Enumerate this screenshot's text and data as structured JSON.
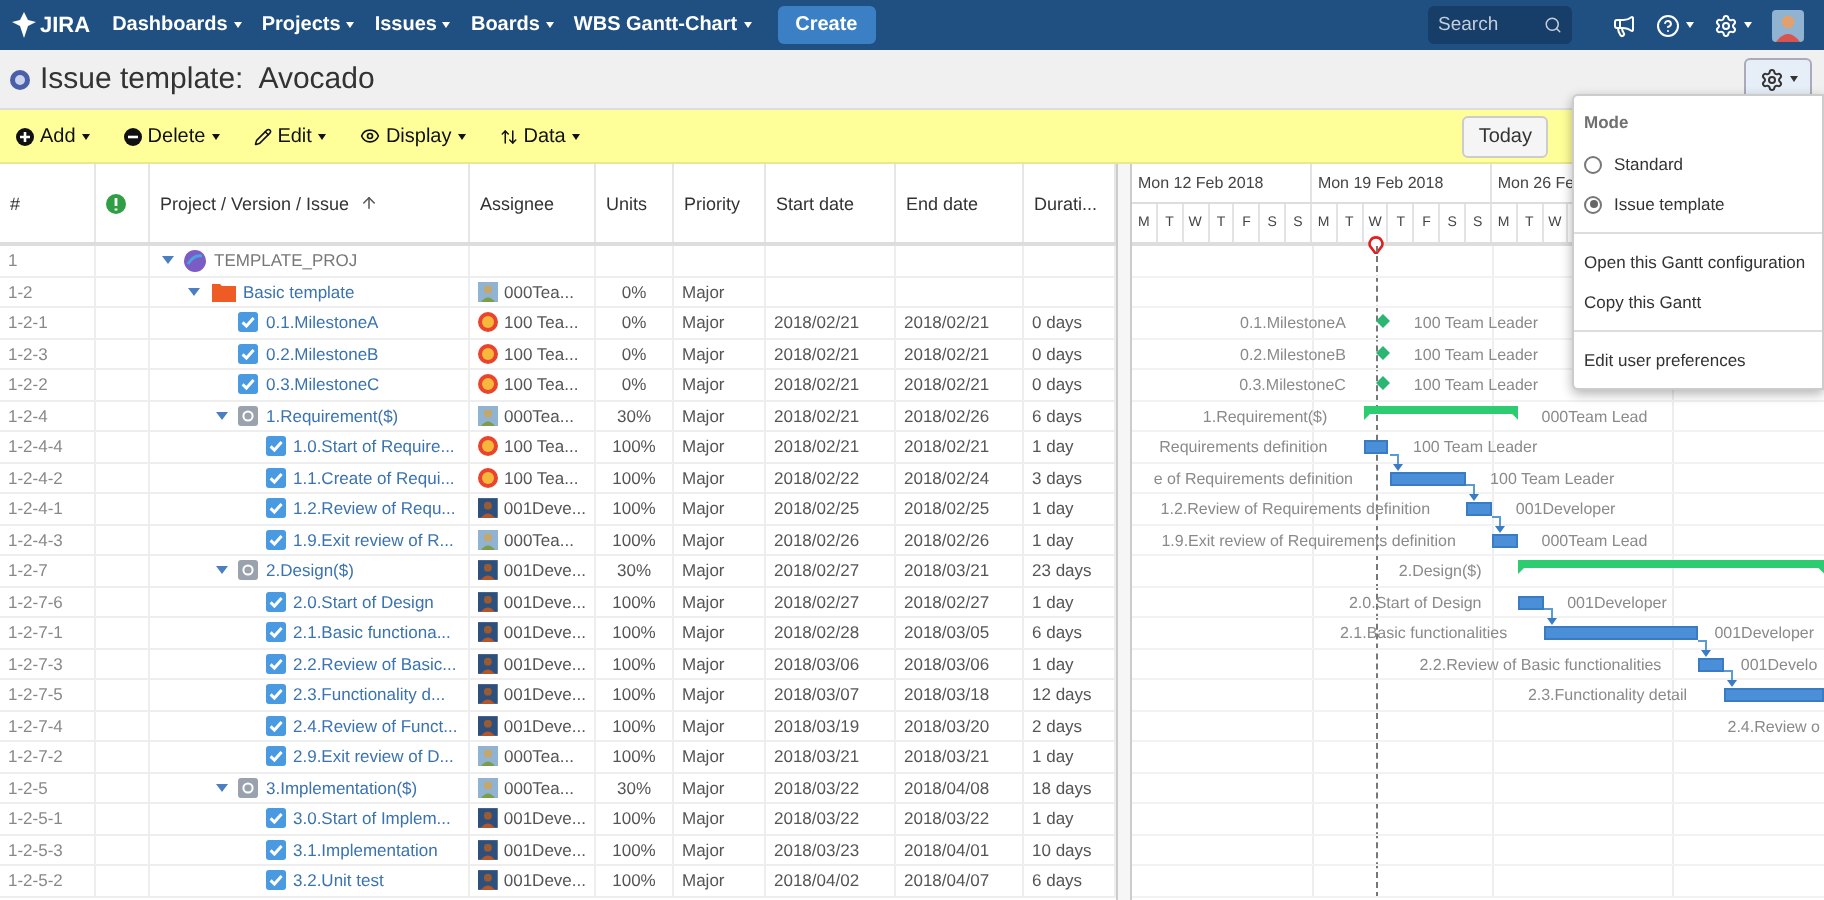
{
  "nav": {
    "logo": "JIRA",
    "items": [
      "Dashboards",
      "Projects",
      "Issues",
      "Boards",
      "WBS Gantt-Chart"
    ],
    "create": "Create",
    "search": {
      "placeholder": "Search"
    }
  },
  "page": {
    "title": "Issue template:  Avocado"
  },
  "toolbar": {
    "menus": [
      "Add",
      "Delete",
      "Edit",
      "Display",
      "Data"
    ],
    "today": "Today"
  },
  "table": {
    "columns": [
      "#",
      "Project / Version / Issue",
      "Assignee",
      "Units",
      "Priority",
      "Start date",
      "End date",
      "Durati..."
    ],
    "rows": [
      {
        "id": "1",
        "kind": "project",
        "title": "TEMPLATE_PROJ",
        "expanded": true,
        "children": [
          {
            "id": "1-2",
            "kind": "version",
            "title": "Basic template",
            "expanded": true,
            "assignee": {
              "name": "000Tea...",
              "kind": "lead"
            },
            "units": "0%",
            "priority": "Major",
            "children": [
              {
                "id": "1-2-1",
                "kind": "milestone",
                "title": "0.1.MilestoneA",
                "assignee": {
                  "name": "100 Tea...",
                  "kind": "leader"
                },
                "units": "0%",
                "priority": "Major",
                "start": "2018/02/21",
                "end": "2018/02/21",
                "duration": "0 days",
                "gantt": {
                  "label": "0.1.MilestoneA",
                  "assignee": "100 Team Leader"
                }
              },
              {
                "id": "1-2-3",
                "kind": "milestone",
                "title": "0.2.MilestoneB",
                "assignee": {
                  "name": "100 Tea...",
                  "kind": "leader"
                },
                "units": "0%",
                "priority": "Major",
                "start": "2018/02/21",
                "end": "2018/02/21",
                "duration": "0 days",
                "gantt": {
                  "label": "0.2.MilestoneB",
                  "assignee": "100 Team Leader"
                }
              },
              {
                "id": "1-2-2",
                "kind": "milestone",
                "title": "0.3.MilestoneC",
                "assignee": {
                  "name": "100 Tea...",
                  "kind": "leader"
                },
                "units": "0%",
                "priority": "Major",
                "start": "2018/02/21",
                "end": "2018/02/21",
                "duration": "0 days",
                "gantt": {
                  "label": "0.3.MilestoneC",
                  "assignee": "100 Team Leader"
                }
              },
              {
                "id": "1-2-4",
                "kind": "summary",
                "title": "1.Requirement($)",
                "expanded": true,
                "assignee": {
                  "name": "000Tea...",
                  "kind": "lead"
                },
                "units": "30%",
                "priority": "Major",
                "start": "2018/02/21",
                "end": "2018/02/26",
                "duration": "6 days",
                "gantt": {
                  "label": "1.Requirement($)",
                  "assignee": "000Team Lead"
                },
                "children": [
                  {
                    "id": "1-2-4-4",
                    "kind": "task",
                    "title": "1.0.Start of Require...",
                    "assignee": {
                      "name": "100 Tea...",
                      "kind": "leader"
                    },
                    "units": "100%",
                    "priority": "Major",
                    "start": "2018/02/21",
                    "end": "2018/02/21",
                    "duration": "1 day",
                    "gantt": {
                      "label": "Requirements definition",
                      "assignee": "100 Team Leader"
                    }
                  },
                  {
                    "id": "1-2-4-2",
                    "kind": "task",
                    "title": "1.1.Create of Requi...",
                    "assignee": {
                      "name": "100 Tea...",
                      "kind": "leader"
                    },
                    "units": "100%",
                    "priority": "Major",
                    "start": "2018/02/22",
                    "end": "2018/02/24",
                    "duration": "3 days",
                    "gantt": {
                      "label": "e of Requirements definition",
                      "assignee": "100 Team Leader"
                    }
                  },
                  {
                    "id": "1-2-4-1",
                    "kind": "task",
                    "title": "1.2.Review of Requ...",
                    "assignee": {
                      "name": "001Deve...",
                      "kind": "developer"
                    },
                    "units": "100%",
                    "priority": "Major",
                    "start": "2018/02/25",
                    "end": "2018/02/25",
                    "duration": "1 day",
                    "gantt": {
                      "label": "1.2.Review of Requirements definition",
                      "assignee": "001Developer"
                    }
                  },
                  {
                    "id": "1-2-4-3",
                    "kind": "task",
                    "title": "1.9.Exit review of R...",
                    "assignee": {
                      "name": "000Tea...",
                      "kind": "lead"
                    },
                    "units": "100%",
                    "priority": "Major",
                    "start": "2018/02/26",
                    "end": "2018/02/26",
                    "duration": "1 day",
                    "gantt": {
                      "label": "1.9.Exit review of Requirements definition",
                      "assignee": "000Team Lead"
                    }
                  }
                ]
              },
              {
                "id": "1-2-7",
                "kind": "summary",
                "title": "2.Design($)",
                "expanded": true,
                "assignee": {
                  "name": "001Deve...",
                  "kind": "developer"
                },
                "units": "30%",
                "priority": "Major",
                "start": "2018/02/27",
                "end": "2018/03/21",
                "duration": "23 days",
                "gantt": {
                  "label": "2.Design($)"
                },
                "children": [
                  {
                    "id": "1-2-7-6",
                    "kind": "task",
                    "title": "2.0.Start of Design",
                    "assignee": {
                      "name": "001Deve...",
                      "kind": "developer"
                    },
                    "units": "100%",
                    "priority": "Major",
                    "start": "2018/02/27",
                    "end": "2018/02/27",
                    "duration": "1 day",
                    "gantt": {
                      "label": "2.0.Start of Design",
                      "assignee": "001Developer"
                    }
                  },
                  {
                    "id": "1-2-7-1",
                    "kind": "task",
                    "title": "2.1.Basic functiona...",
                    "assignee": {
                      "name": "001Deve...",
                      "kind": "developer"
                    },
                    "units": "100%",
                    "priority": "Major",
                    "start": "2018/02/28",
                    "end": "2018/03/05",
                    "duration": "6 days",
                    "gantt": {
                      "label": "2.1.Basic functionalities",
                      "assignee": "001Developer"
                    }
                  },
                  {
                    "id": "1-2-7-3",
                    "kind": "task",
                    "title": "2.2.Review of Basic...",
                    "assignee": {
                      "name": "001Deve...",
                      "kind": "developer"
                    },
                    "units": "100%",
                    "priority": "Major",
                    "start": "2018/03/06",
                    "end": "2018/03/06",
                    "duration": "1 day",
                    "gantt": {
                      "label": "2.2.Review of Basic functionalities",
                      "assignee": "001Develo"
                    }
                  },
                  {
                    "id": "1-2-7-5",
                    "kind": "task",
                    "title": "2.3.Functionality d...",
                    "assignee": {
                      "name": "001Deve...",
                      "kind": "developer"
                    },
                    "units": "100%",
                    "priority": "Major",
                    "start": "2018/03/07",
                    "end": "2018/03/18",
                    "duration": "12 days",
                    "gantt": {
                      "label": "2.3.Functionality detail"
                    }
                  },
                  {
                    "id": "1-2-7-4",
                    "kind": "task",
                    "title": "2.4.Review of Funct...",
                    "assignee": {
                      "name": "001Deve...",
                      "kind": "developer"
                    },
                    "units": "100%",
                    "priority": "Major",
                    "start": "2018/03/19",
                    "end": "2018/03/20",
                    "duration": "2 days",
                    "gantt": {
                      "label": "2.4.Review o"
                    }
                  },
                  {
                    "id": "1-2-7-2",
                    "kind": "task",
                    "title": "2.9.Exit review of D...",
                    "assignee": {
                      "name": "000Tea...",
                      "kind": "lead"
                    },
                    "units": "100%",
                    "priority": "Major",
                    "start": "2018/03/21",
                    "end": "2018/03/21",
                    "duration": "1 day"
                  }
                ]
              },
              {
                "id": "1-2-5",
                "kind": "summary",
                "title": "3.Implementation($)",
                "expanded": true,
                "assignee": {
                  "name": "000Tea...",
                  "kind": "lead"
                },
                "units": "30%",
                "priority": "Major",
                "start": "2018/03/22",
                "end": "2018/04/08",
                "duration": "18 days",
                "children": [
                  {
                    "id": "1-2-5-1",
                    "kind": "task",
                    "title": "3.0.Start of Implem...",
                    "assignee": {
                      "name": "001Deve...",
                      "kind": "developer"
                    },
                    "units": "100%",
                    "priority": "Major",
                    "start": "2018/03/22",
                    "end": "2018/03/22",
                    "duration": "1 day"
                  },
                  {
                    "id": "1-2-5-3",
                    "kind": "task",
                    "title": "3.1.Implementation",
                    "assignee": {
                      "name": "001Deve...",
                      "kind": "developer"
                    },
                    "units": "100%",
                    "priority": "Major",
                    "start": "2018/03/23",
                    "end": "2018/04/01",
                    "duration": "10 days"
                  },
                  {
                    "id": "1-2-5-2",
                    "kind": "task",
                    "title": "3.2.Unit test",
                    "assignee": {
                      "name": "001Deve...",
                      "kind": "developer"
                    },
                    "units": "100%",
                    "priority": "Major",
                    "start": "2018/04/02",
                    "end": "2018/04/07",
                    "duration": "6 days"
                  }
                ]
              }
            ]
          }
        ]
      }
    ]
  },
  "gantt": {
    "weeks": [
      "Mon 12 Feb 2018",
      "Mon 19 Feb 2018",
      "Mon 26 Fe"
    ],
    "days": [
      {
        "label": "M",
        "today": false
      },
      {
        "label": "T",
        "today": false
      },
      {
        "label": "W",
        "today": false
      },
      {
        "label": "T",
        "today": false
      },
      {
        "label": "F",
        "today": false
      },
      {
        "label": "S",
        "today": false
      },
      {
        "label": "S",
        "today": false
      },
      {
        "label": "M",
        "today": false
      },
      {
        "label": "T",
        "today": false
      },
      {
        "label": "W",
        "today": true
      },
      {
        "label": "T",
        "today": false
      },
      {
        "label": "F",
        "today": false
      },
      {
        "label": "S",
        "today": false
      },
      {
        "label": "S",
        "today": false
      },
      {
        "label": "M",
        "today": false
      },
      {
        "label": "T",
        "today": false
      },
      {
        "label": "W",
        "today": false
      }
    ]
  },
  "settings_menu": {
    "heading": "Mode",
    "modes": [
      {
        "label": "Standard",
        "selected": false
      },
      {
        "label": "Issue template",
        "selected": true
      }
    ],
    "actions": [
      "Open this Gantt configuration",
      "Copy this Gantt",
      "Edit user preferences"
    ]
  }
}
